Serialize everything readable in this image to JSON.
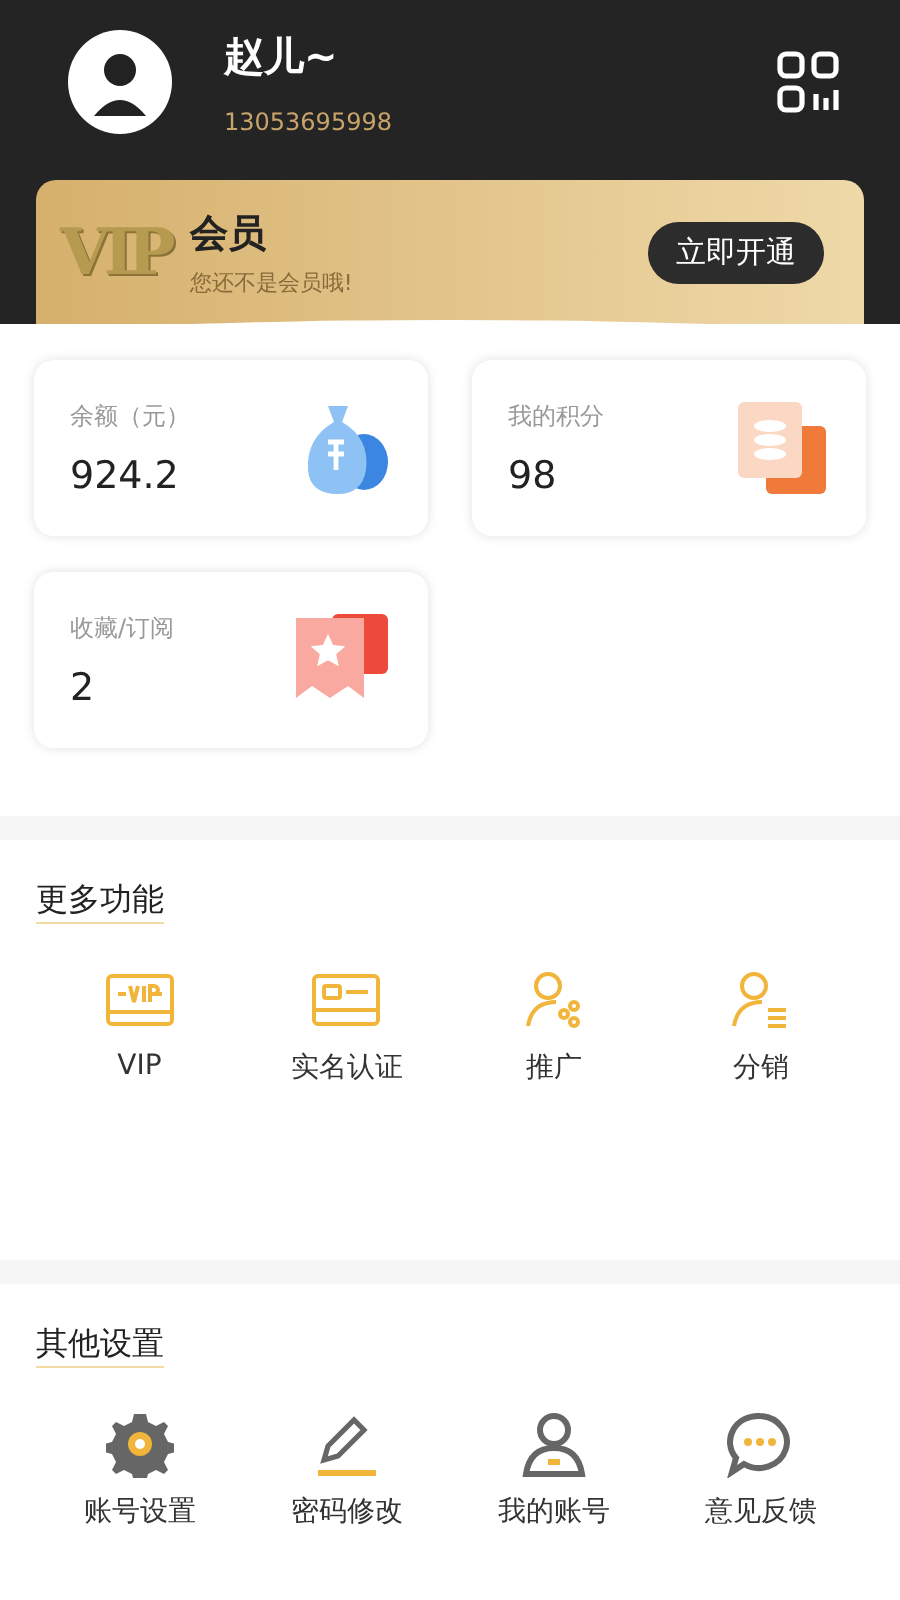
{
  "profile": {
    "name": "赵儿~",
    "phone": "13053695998"
  },
  "vip_banner": {
    "badge": "VIP",
    "title": "会员",
    "subtitle": "您还不是会员哦!",
    "button": "立即开通"
  },
  "stats": [
    {
      "label": "余额（元）",
      "value": "924.2",
      "kind": "balance"
    },
    {
      "label": "我的积分",
      "value": "98",
      "kind": "points"
    },
    {
      "label": "收藏/订阅",
      "value": "2",
      "kind": "favorites"
    }
  ],
  "sections": [
    {
      "title": "更多功能",
      "items": [
        {
          "label": "VIP",
          "kind": "vip"
        },
        {
          "label": "实名认证",
          "kind": "idcard"
        },
        {
          "label": "推广",
          "kind": "share"
        },
        {
          "label": "分销",
          "kind": "distribution"
        }
      ]
    },
    {
      "title": "其他设置",
      "items": [
        {
          "label": "账号设置",
          "kind": "gear"
        },
        {
          "label": "密码修改",
          "kind": "pencil"
        },
        {
          "label": "我的账号",
          "kind": "account"
        },
        {
          "label": "意见反馈",
          "kind": "feedback"
        }
      ]
    }
  ]
}
